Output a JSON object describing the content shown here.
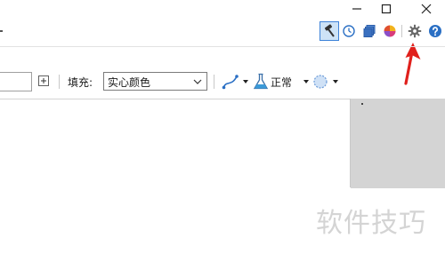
{
  "window_controls": {
    "minimize_icon": "minimize-icon",
    "maximize_icon": "maximize-icon",
    "close_icon": "close-icon"
  },
  "top_tools": [
    {
      "icon": "hammer-icon",
      "active": true
    },
    {
      "icon": "history-icon",
      "active": false
    },
    {
      "icon": "layers-icon",
      "active": false
    },
    {
      "icon": "color-wheel-icon",
      "active": false
    },
    {
      "icon": "gear-icon",
      "active": false
    },
    {
      "icon": "help-icon",
      "active": false
    }
  ],
  "toolbar": {
    "fill_label": "填充:",
    "fill_value": "实心颜色",
    "blend_mode": "正常"
  },
  "annotation": {
    "color": "#e0201c",
    "points_to": "gear-icon"
  },
  "colors": {
    "accent": "#3d82d8",
    "panel_gray": "#d4d4d4"
  },
  "watermark": "软件技巧"
}
